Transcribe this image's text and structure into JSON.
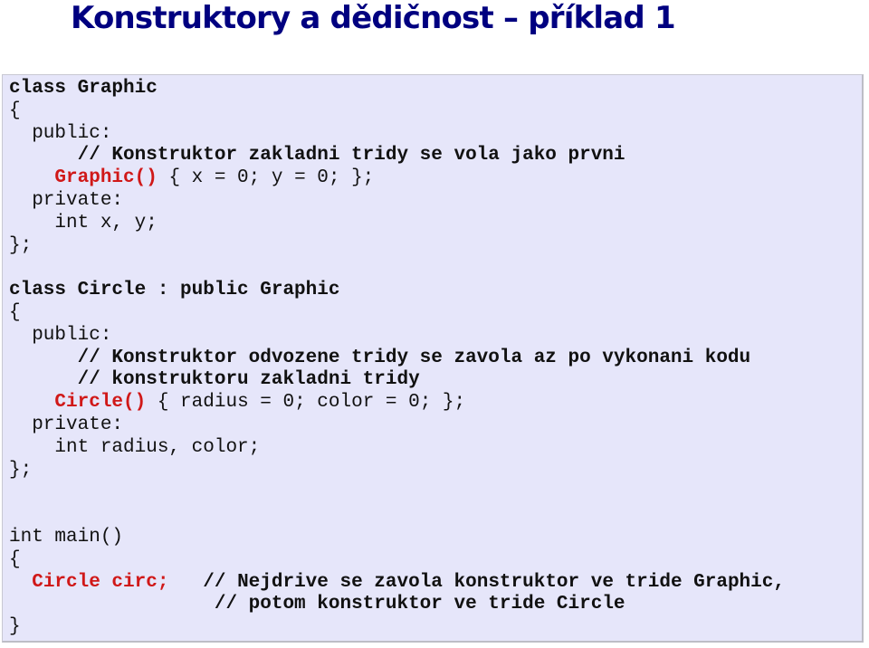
{
  "title": "Konstruktory a dědičnost – příklad 1",
  "colors": {
    "title": "#000080",
    "code_background": "#e6e6fa",
    "highlight": "#d01818",
    "code_text": "#111111"
  },
  "code": {
    "graphic_class": {
      "header": "class Graphic",
      "open_brace": "{",
      "public_label": "  public:",
      "comment": "      // Konstruktor zakladni tridy se vola jako prvni",
      "ctor_indent": "    ",
      "ctor_name": "Graphic()",
      "ctor_body": " { x = 0; y = 0; };",
      "private_label": "  private:",
      "members": "    int x, y;",
      "close": "};"
    },
    "circle_class": {
      "header": "class Circle : public Graphic",
      "open_brace": "{",
      "public_label": "  public:",
      "comment_1": "      // Konstruktor odvozene tridy se zavola az po vykonani kodu",
      "comment_2": "      // konstruktoru zakladni tridy",
      "ctor_indent": "    ",
      "ctor_name": "Circle()",
      "ctor_body": " { radius = 0; color = 0; };",
      "private_label": "  private:",
      "members": "    int radius, color;",
      "close": "};"
    },
    "main_function": {
      "header": "int main()",
      "open_brace": "{",
      "stmt_indent": "  ",
      "stmt": "Circle circ;",
      "stmt_gap": "   ",
      "comment_1": "// Nejdrive se zavola konstruktor ve tride Graphic,",
      "comment_2_indent": "                  ",
      "comment_2": "// potom konstruktor ve tride Circle",
      "close": "}"
    }
  }
}
